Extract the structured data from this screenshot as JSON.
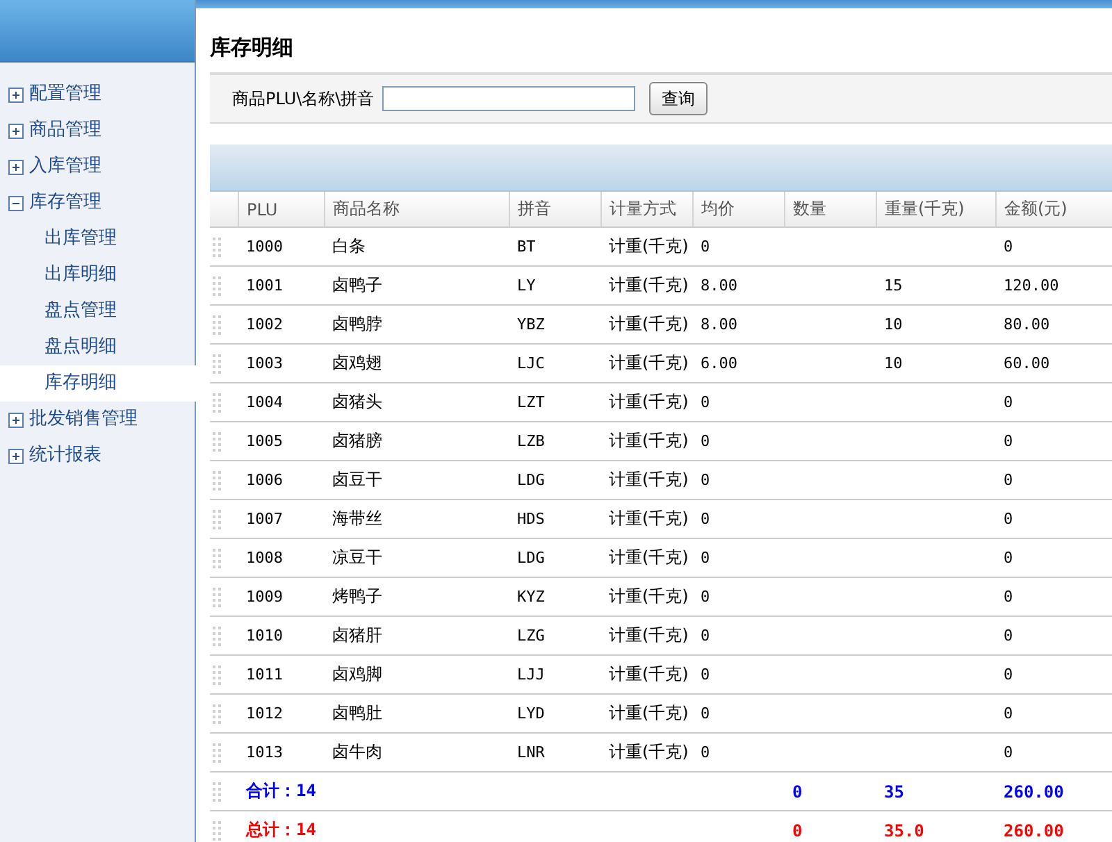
{
  "sidebar": {
    "items": [
      {
        "label": "配置管理",
        "expanded": false,
        "selected": false
      },
      {
        "label": "商品管理",
        "expanded": false,
        "selected": false
      },
      {
        "label": "入库管理",
        "expanded": false,
        "selected": false
      },
      {
        "label": "库存管理",
        "expanded": true,
        "selected": false,
        "children": [
          {
            "label": "出库管理",
            "selected": false
          },
          {
            "label": "出库明细",
            "selected": false
          },
          {
            "label": "盘点管理",
            "selected": false
          },
          {
            "label": "盘点明细",
            "selected": false
          },
          {
            "label": "库存明细",
            "selected": true
          }
        ]
      },
      {
        "label": "批发销售管理",
        "expanded": false,
        "selected": false
      },
      {
        "label": "统计报表",
        "expanded": false,
        "selected": false
      }
    ]
  },
  "page": {
    "title": "库存明细"
  },
  "search": {
    "label": "商品PLU\\名称\\拼音",
    "button": "查询"
  },
  "table": {
    "columns": [
      "PLU",
      "商品名称",
      "拼音",
      "计量方式",
      "均价",
      "数量",
      "重量(千克)",
      "金额(元)"
    ],
    "rows": [
      {
        "plu": "1000",
        "name": "白条",
        "pinyin": "BT",
        "method": "计重(千克)",
        "avg_price": "0",
        "amount": "0"
      },
      {
        "plu": "1001",
        "name": "卤鸭子",
        "pinyin": "LY",
        "method": "计重(千克)",
        "avg_price": "8.00",
        "weight": "15",
        "amount": "120.00"
      },
      {
        "plu": "1002",
        "name": "卤鸭脖",
        "pinyin": "YBZ",
        "method": "计重(千克)",
        "avg_price": "8.00",
        "weight": "10",
        "amount": "80.00"
      },
      {
        "plu": "1003",
        "name": "卤鸡翅",
        "pinyin": "LJC",
        "method": "计重(千克)",
        "avg_price": "6.00",
        "weight": "10",
        "amount": "60.00"
      },
      {
        "plu": "1004",
        "name": "卤猪头",
        "pinyin": "LZT",
        "method": "计重(千克)",
        "avg_price": "0",
        "amount": "0"
      },
      {
        "plu": "1005",
        "name": "卤猪膀",
        "pinyin": "LZB",
        "method": "计重(千克)",
        "avg_price": "0",
        "amount": "0"
      },
      {
        "plu": "1006",
        "name": "卤豆干",
        "pinyin": "LDG",
        "method": "计重(千克)",
        "avg_price": "0",
        "amount": "0"
      },
      {
        "plu": "1007",
        "name": "海带丝",
        "pinyin": "HDS",
        "method": "计重(千克)",
        "avg_price": "0",
        "amount": "0"
      },
      {
        "plu": "1008",
        "name": "凉豆干",
        "pinyin": "LDG",
        "method": "计重(千克)",
        "avg_price": "0",
        "amount": "0"
      },
      {
        "plu": "1009",
        "name": "烤鸭子",
        "pinyin": "KYZ",
        "method": "计重(千克)",
        "avg_price": "0",
        "amount": "0"
      },
      {
        "plu": "1010",
        "name": "卤猪肝",
        "pinyin": "LZG",
        "method": "计重(千克)",
        "avg_price": "0",
        "amount": "0"
      },
      {
        "plu": "1011",
        "name": "卤鸡脚",
        "pinyin": "LJJ",
        "method": "计重(千克)",
        "avg_price": "0",
        "amount": "0"
      },
      {
        "plu": "1012",
        "name": "卤鸭肚",
        "pinyin": "LYD",
        "method": "计重(千克)",
        "avg_price": "0",
        "amount": "0"
      },
      {
        "plu": "1013",
        "name": "卤牛肉",
        "pinyin": "LNR",
        "method": "计重(千克)",
        "avg_price": "0",
        "amount": "0"
      }
    ],
    "summary_rows": [
      {
        "color": "#0000ff",
        "label": "合计：14",
        "quantity": "0",
        "weight": "35",
        "amount": "260.00"
      },
      {
        "color": "#ff0000",
        "label": "总计：14",
        "quantity": "0",
        "weight": "35.0",
        "amount": "260.00"
      }
    ]
  }
}
